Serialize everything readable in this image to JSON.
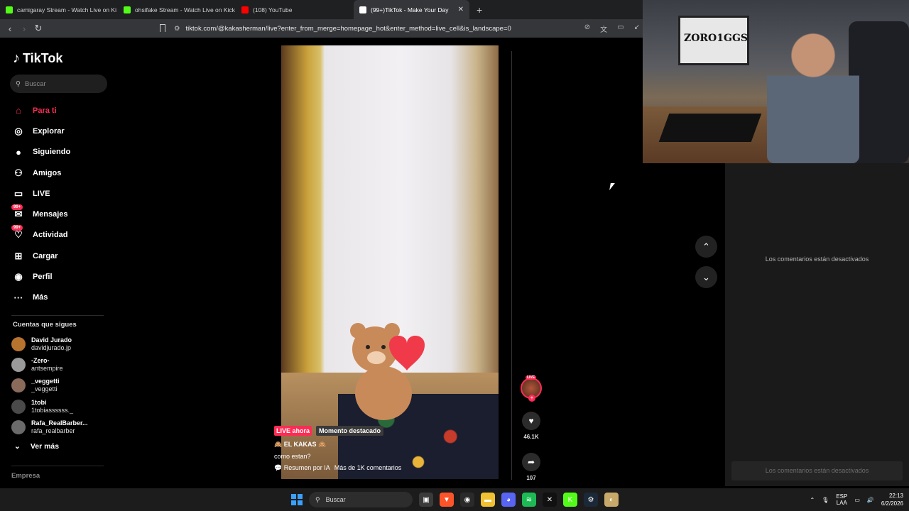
{
  "browser": {
    "tabs": [
      {
        "title": "camigaray Stream - Watch Live on Ki",
        "icon_color": "#53fc18"
      },
      {
        "title": "ohsifake Stream - Watch Live on Kick",
        "icon_color": "#53fc18"
      },
      {
        "title": "(108) YouTube",
        "icon_color": "#ff0000"
      },
      {
        "title": "(99+)TikTok - Make Your Day",
        "icon_color": "#ffffff"
      }
    ],
    "url": "tiktok.com/@kakasherman/live?enter_from_merge=homepage_hot&enter_method=live_cell&is_landscape=0"
  },
  "sidebar": {
    "logo": "TikTok",
    "search_placeholder": "Buscar",
    "nav": [
      {
        "label": "Para ti",
        "icon": "home-icon",
        "glyph": "⌂"
      },
      {
        "label": "Explorar",
        "icon": "compass-icon",
        "glyph": "◎"
      },
      {
        "label": "Siguiendo",
        "icon": "following-icon",
        "glyph": "●"
      },
      {
        "label": "Amigos",
        "icon": "friends-icon",
        "glyph": "⚇"
      },
      {
        "label": "LIVE",
        "icon": "live-tv-icon",
        "glyph": "▭"
      },
      {
        "label": "Mensajes",
        "icon": "messages-icon",
        "glyph": "✉",
        "badge": "99+"
      },
      {
        "label": "Actividad",
        "icon": "activity-icon",
        "glyph": "♡",
        "badge": "99+"
      },
      {
        "label": "Cargar",
        "icon": "upload-icon",
        "glyph": "⊞"
      },
      {
        "label": "Perfil",
        "icon": "profile-icon",
        "glyph": "◉"
      },
      {
        "label": "Más",
        "icon": "more-icon",
        "glyph": "···"
      }
    ],
    "follows_title": "Cuentas que sigues",
    "follows": [
      {
        "name": "David Jurado",
        "user": "davidjurado.jp",
        "color": "#b8742f"
      },
      {
        "name": "-Zero-",
        "user": "antsempire",
        "color": "#9a9a9a"
      },
      {
        "name": "_veggetti",
        "user": "_veggetti",
        "color": "#8a6a5a"
      },
      {
        "name": "1tobi",
        "user": "1tobiassssss._",
        "color": "#4a4a4a"
      },
      {
        "name": "Rafa_RealBarber...",
        "user": "rafa_realbarber",
        "color": "#6a6a6a"
      }
    ],
    "see_more": "Ver más",
    "company": "Empresa"
  },
  "live": {
    "live_badge": "LIVE ahora",
    "moment": "Momento destacado",
    "streamer": "🙈 EL KAKAS 🙈",
    "text": "como estan?",
    "summary_prefix": "💬 Resumen por IA",
    "summary_count": "Más de 1K comentarios",
    "avatar_tag": "LIVE",
    "likes": "46.1K",
    "shares": "107"
  },
  "comments": {
    "disabled_msg": "Los comentarios están desactivados",
    "input_placeholder": "Los comentarios están desactivados"
  },
  "webcam": {
    "poster_text": "ZORO1GGS"
  },
  "taskbar": {
    "search": "Buscar",
    "lang_top": "ESP",
    "lang_bottom": "LAA",
    "time": "22:13",
    "date": "6/2/2026",
    "apps": [
      {
        "name": "task-view-icon",
        "color": "#3a3a3a",
        "glyph": "▣"
      },
      {
        "name": "brave-icon",
        "color": "#fb542b",
        "glyph": "▼"
      },
      {
        "name": "chrome-icon",
        "color": "#2a2a2a",
        "glyph": "◉"
      },
      {
        "name": "explorer-icon",
        "color": "#f2c132",
        "glyph": "▬"
      },
      {
        "name": "discord-icon",
        "color": "#5865f2",
        "glyph": "◕"
      },
      {
        "name": "spotify-icon",
        "color": "#1db954",
        "glyph": "≋"
      },
      {
        "name": "capcut-icon",
        "color": "#111111",
        "glyph": "✕"
      },
      {
        "name": "kick-icon",
        "color": "#53fc18",
        "glyph": "K"
      },
      {
        "name": "steam-icon",
        "color": "#1b2838",
        "glyph": "⚙"
      },
      {
        "name": "app-icon",
        "color": "#c9a96a",
        "glyph": "◐"
      }
    ]
  }
}
